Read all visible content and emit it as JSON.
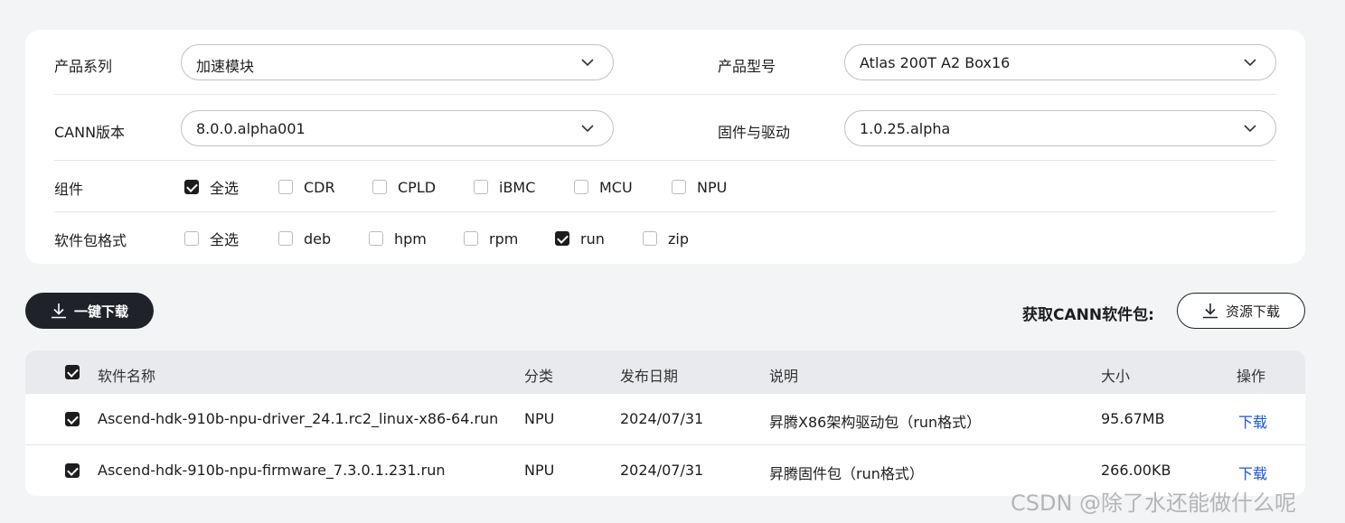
{
  "filters": {
    "product_series": {
      "label": "产品系列",
      "value": "加速模块"
    },
    "product_model": {
      "label": "产品型号",
      "value": "Atlas 200T A2 Box16"
    },
    "cann_version": {
      "label": "CANN版本",
      "value": "8.0.0.alpha001"
    },
    "firmware_driver": {
      "label": "固件与驱动",
      "value": "1.0.25.alpha"
    },
    "components": {
      "label": "组件",
      "options": [
        {
          "label": "全选",
          "checked": true
        },
        {
          "label": "CDR",
          "checked": false
        },
        {
          "label": "CPLD",
          "checked": false
        },
        {
          "label": "iBMC",
          "checked": false
        },
        {
          "label": "MCU",
          "checked": false
        },
        {
          "label": "NPU",
          "checked": false
        }
      ]
    },
    "package_format": {
      "label": "软件包格式",
      "options": [
        {
          "label": "全选",
          "checked": false
        },
        {
          "label": "deb",
          "checked": false
        },
        {
          "label": "hpm",
          "checked": false
        },
        {
          "label": "rpm",
          "checked": false
        },
        {
          "label": "run",
          "checked": true
        },
        {
          "label": "zip",
          "checked": false
        }
      ]
    }
  },
  "actions": {
    "one_click_download": "一键下载",
    "get_cann_label": "获取CANN软件包:",
    "resource_download": "资源下载"
  },
  "table": {
    "headers": {
      "name": "软件名称",
      "category": "分类",
      "date": "发布日期",
      "desc": "说明",
      "size": "大小",
      "op": "操作"
    },
    "header_checked": true,
    "rows": [
      {
        "checked": true,
        "name": "Ascend-hdk-910b-npu-driver_24.1.rc2_linux-x86-64.run",
        "category": "NPU",
        "date": "2024/07/31",
        "desc": "昇腾X86架构驱动包（run格式）",
        "size": "95.67MB",
        "op": "下载"
      },
      {
        "checked": true,
        "name": "Ascend-hdk-910b-npu-firmware_7.3.0.1.231.run",
        "category": "NPU",
        "date": "2024/07/31",
        "desc": "昇腾固件包（run格式）",
        "size": "266.00KB",
        "op": "下载"
      }
    ]
  },
  "watermark": "CSDN @除了水还能做什么呢"
}
